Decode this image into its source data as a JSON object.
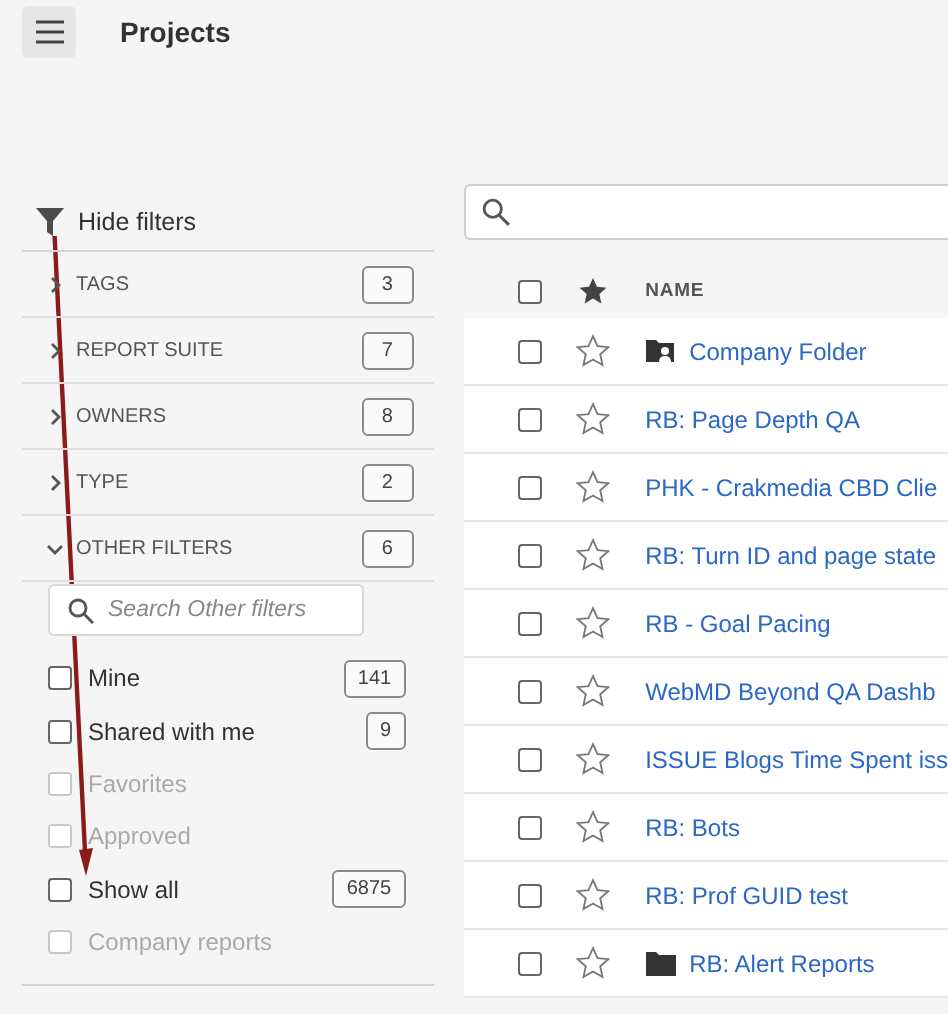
{
  "header": {
    "title": "Projects"
  },
  "filters": {
    "toggle_label": "Hide filters",
    "groups": [
      {
        "label": "TAGS",
        "count": "3",
        "expanded": false
      },
      {
        "label": "REPORT SUITE",
        "count": "7",
        "expanded": false
      },
      {
        "label": "OWNERS",
        "count": "8",
        "expanded": false
      },
      {
        "label": "TYPE",
        "count": "2",
        "expanded": false
      },
      {
        "label": "OTHER FILTERS",
        "count": "6",
        "expanded": true
      }
    ],
    "search": {
      "placeholder": "Search Other filters"
    },
    "options": [
      {
        "label": "Mine",
        "count": "141",
        "checked": false,
        "disabled": false
      },
      {
        "label": "Shared with me",
        "count": "9",
        "checked": false,
        "disabled": false
      },
      {
        "label": "Favorites",
        "checked": false,
        "disabled": true
      },
      {
        "label": "Approved",
        "checked": false,
        "disabled": true
      },
      {
        "label": "Show all",
        "count": "6875",
        "checked": false,
        "disabled": false
      },
      {
        "label": "Company reports",
        "checked": false,
        "disabled": true
      }
    ]
  },
  "table": {
    "columns": [
      "NAME"
    ],
    "select_all_checked": false,
    "rows": [
      {
        "name": "Company Folder",
        "kind": "shared-folder",
        "checked": false,
        "starred": false
      },
      {
        "name": "RB: Page Depth QA",
        "kind": "project",
        "checked": false,
        "starred": false
      },
      {
        "name": "PHK - Crakmedia CBD Clie",
        "kind": "project",
        "checked": false,
        "starred": false
      },
      {
        "name": "RB: Turn ID and page state",
        "kind": "project",
        "checked": false,
        "starred": false
      },
      {
        "name": "RB - Goal Pacing",
        "kind": "project",
        "checked": false,
        "starred": false
      },
      {
        "name": "WebMD Beyond QA Dashb",
        "kind": "project",
        "checked": false,
        "starred": false
      },
      {
        "name": "ISSUE Blogs Time Spent iss",
        "kind": "project",
        "checked": false,
        "starred": false
      },
      {
        "name": "RB: Bots",
        "kind": "project",
        "checked": false,
        "starred": false
      },
      {
        "name": "RB: Prof GUID test",
        "kind": "project",
        "checked": false,
        "starred": false
      },
      {
        "name": "RB: Alert Reports",
        "kind": "folder",
        "checked": false,
        "starred": false
      }
    ]
  }
}
